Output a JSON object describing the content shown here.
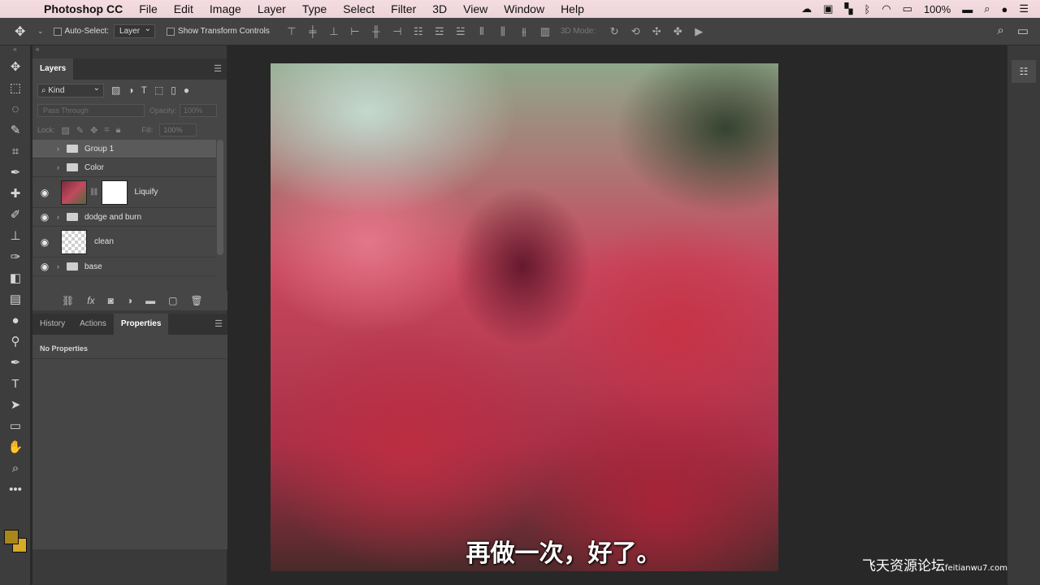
{
  "menubar": {
    "app_name": "Photoshop CC",
    "items": [
      "File",
      "Edit",
      "Image",
      "Layer",
      "Type",
      "Select",
      "Filter",
      "3D",
      "View",
      "Window",
      "Help"
    ],
    "battery": "100%"
  },
  "options": {
    "auto_select_label": "Auto-Select:",
    "auto_select_value": "Layer",
    "show_transform_label": "Show Transform Controls",
    "mode_3d_label": "3D Mode:"
  },
  "layers_panel": {
    "tab": "Layers",
    "filter_kind": "Kind",
    "blend_mode": "Pass Through",
    "opacity_label": "Opacity:",
    "opacity_value": "100%",
    "lock_label": "Lock:",
    "fill_label": "Fill:",
    "fill_value": "100%",
    "layers": [
      {
        "name": "Group 1",
        "type": "group",
        "visible": false,
        "selected": true
      },
      {
        "name": "Color",
        "type": "group",
        "visible": false,
        "selected": false
      },
      {
        "name": "Liquify",
        "type": "smart",
        "visible": true,
        "selected": false
      },
      {
        "name": "dodge and burn",
        "type": "group",
        "visible": true,
        "selected": false
      },
      {
        "name": "clean",
        "type": "pixel",
        "visible": true,
        "selected": false
      },
      {
        "name": "base",
        "type": "group",
        "visible": true,
        "selected": false
      }
    ]
  },
  "lower_panel": {
    "tabs": [
      "History",
      "Actions",
      "Properties"
    ],
    "active_tab": "Properties",
    "message": "No Properties"
  },
  "canvas": {
    "subtitle": "再做一次，好了。"
  },
  "watermark": {
    "text": "飞天资源论坛",
    "url": "feitianwu7.com"
  }
}
